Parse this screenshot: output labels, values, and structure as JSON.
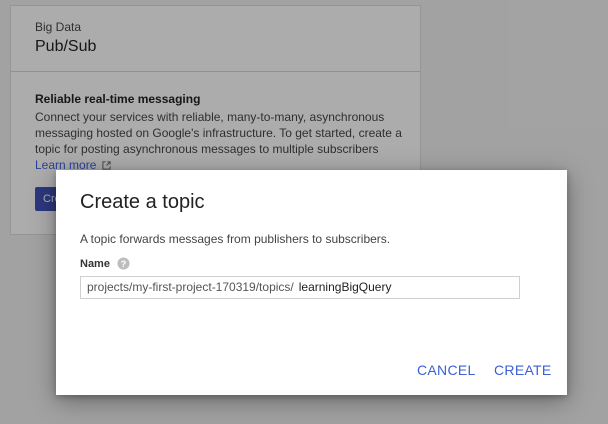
{
  "background": {
    "category": "Big Data",
    "product": "Pub/Sub",
    "body_title": "Reliable real-time messaging",
    "body_text": "Connect your services with reliable, many-to-many, asynchronous messaging hosted on Google's infrastructure. To get started, create a topic for posting asynchronous messages to multiple subscribers",
    "learn_more": "Learn more",
    "create_button": "Create topic"
  },
  "dialog": {
    "title": "Create a topic",
    "description": "A topic forwards messages from publishers to subscribers.",
    "field_label": "Name",
    "name_prefix": "projects/my-first-project-170319/topics/",
    "name_value": "learningBigQuery",
    "cancel_label": "CANCEL",
    "create_label": "CREATE"
  },
  "colors": {
    "accent": "#3b5fd6",
    "primary_button": "#3f51b5"
  }
}
